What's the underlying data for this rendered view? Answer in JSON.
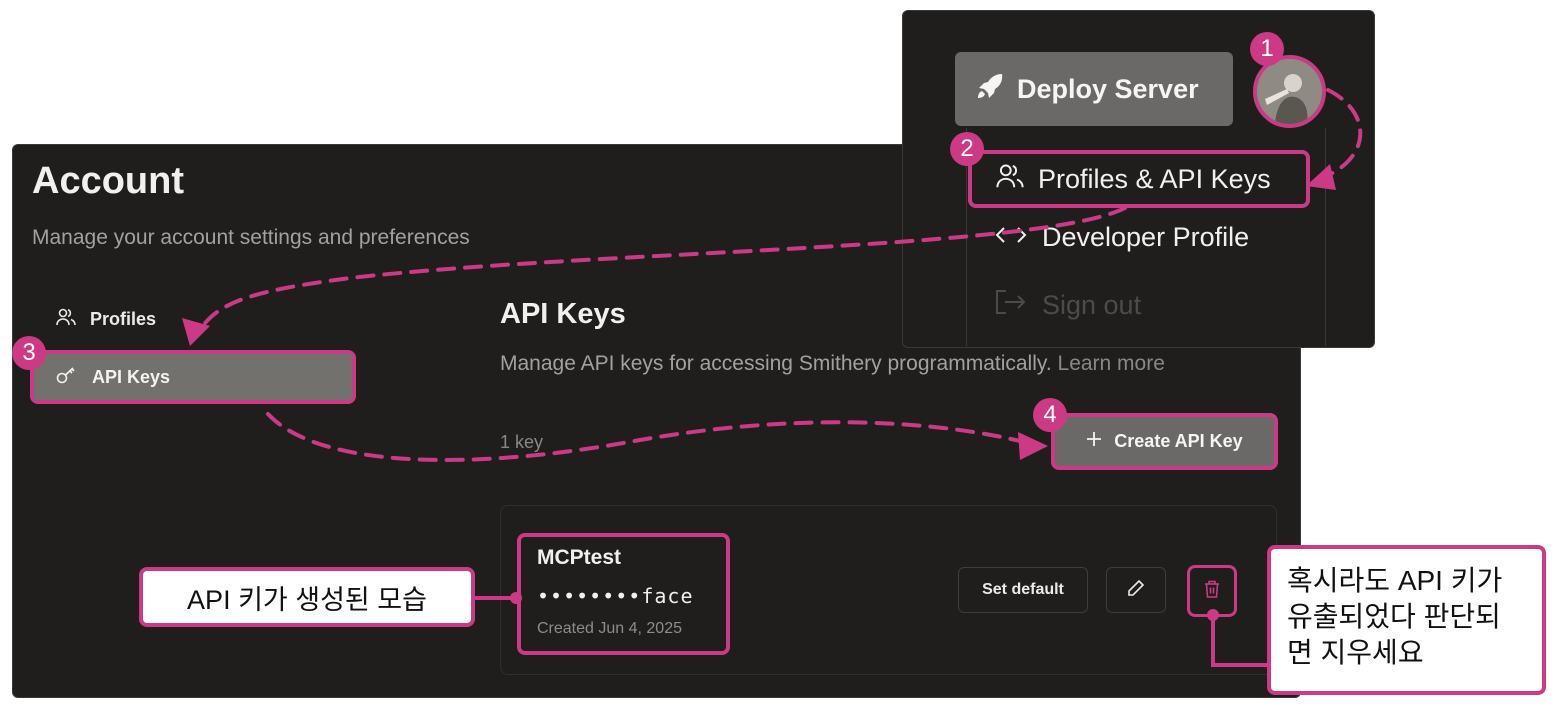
{
  "account": {
    "title": "Account",
    "subtitle": "Manage your account settings and preferences"
  },
  "sidebar": {
    "items": [
      {
        "label": "Profiles",
        "icon": "users-icon",
        "active": false
      },
      {
        "label": "API Keys",
        "icon": "key-icon",
        "active": true
      }
    ]
  },
  "api_keys": {
    "title": "API Keys",
    "subtitle": "Manage API keys for accessing Smithery programmatically.",
    "learn_more": "Learn more",
    "count_label": "1 key",
    "create_label": "Create API Key",
    "keys": [
      {
        "name": "MCPtest",
        "masked": "••••••••face",
        "created": "Created Jun 4, 2025",
        "set_default_label": "Set default"
      }
    ]
  },
  "header": {
    "deploy_label": "Deploy Server"
  },
  "dropdown": {
    "items": [
      {
        "label": "Profiles & API Keys",
        "icon": "users-icon"
      },
      {
        "label": "Developer Profile",
        "icon": "code-arrows-icon"
      },
      {
        "label": "Sign out",
        "icon": "sign-out-icon",
        "disabled": true
      }
    ]
  },
  "annotations": {
    "steps": [
      "1",
      "2",
      "3",
      "4"
    ],
    "callout_created": "API 키가 생성된 모습",
    "callout_delete_lines": [
      "혹시라도 API 키가",
      "유출되었다 판단되",
      "면 지우세요"
    ],
    "accent_color": "#cc3a86"
  }
}
